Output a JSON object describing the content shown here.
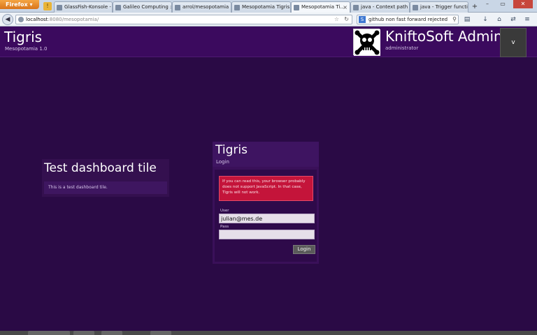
{
  "browser": {
    "menu_label": "Firefox",
    "tabs": [
      {
        "label": "GlassFish-Konsole - ...",
        "active": false
      },
      {
        "label": "Galileo Computing :...",
        "active": false
      },
      {
        "label": "arrol/mesopotamia ...",
        "active": false
      },
      {
        "label": "Mesopotamia Tigris",
        "active": false
      },
      {
        "label": "Mesopotamia Ti...",
        "active": true
      },
      {
        "label": "java - Context path ...",
        "active": false
      },
      {
        "label": "java - Trigger functi...",
        "active": false
      }
    ],
    "new_tab_symbol": "+",
    "url_host": "localhost",
    "url_path": ":8080/mesopotamia/",
    "search_engine": "S",
    "search_value": "github non fast forward rejected",
    "icons": [
      "warning-icon",
      "back-icon",
      "globe-icon",
      "star-icon",
      "reload-icon",
      "search-icon",
      "bookmarks-icon",
      "download-icon",
      "home-icon",
      "sync-icon",
      "menu-icon"
    ]
  },
  "header": {
    "title": "Tigris",
    "subtitle": "Mesopotamia 1.0",
    "admin_name": "KniftoSoft Admin",
    "admin_role": "administrator",
    "menu_label": "v"
  },
  "dashboard_tile": {
    "title": "Test dashboard tile",
    "body": "This is a test dashboard tile."
  },
  "login": {
    "title": "Tigris",
    "subtitle": "Login",
    "warning": "If you can read this, your browser probably does not support JavaScript. In that case, Tigris will not work.",
    "user_label": "User",
    "user_value": "julian@mes.de",
    "pass_label": "Pass",
    "pass_value": "",
    "button_label": "Login"
  },
  "colors": {
    "background": "#2a0a45",
    "header": "#3b0a5e",
    "warning": "#c4143a"
  }
}
